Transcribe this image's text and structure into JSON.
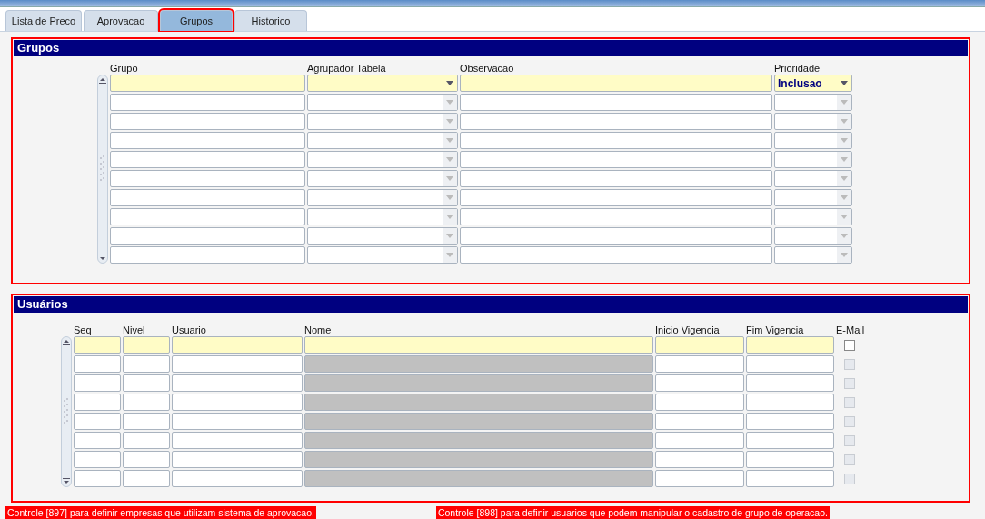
{
  "tabs": [
    {
      "label": "Lista de Preco",
      "selected": false
    },
    {
      "label": "Aprovacao",
      "selected": false
    },
    {
      "label": "Grupos",
      "selected": true
    },
    {
      "label": "Historico",
      "selected": false
    }
  ],
  "grupos": {
    "title": "Grupos",
    "columns": [
      {
        "label": "Grupo",
        "kind": "text"
      },
      {
        "label": "Agrupador Tabela",
        "kind": "dropdown"
      },
      {
        "label": "Observacao",
        "kind": "text"
      },
      {
        "label": "Prioridade",
        "kind": "dropdown"
      }
    ],
    "rows": [
      {
        "current": true,
        "prioridade": "Inclusao"
      },
      {
        "current": false
      },
      {
        "current": false
      },
      {
        "current": false
      },
      {
        "current": false
      },
      {
        "current": false
      },
      {
        "current": false
      },
      {
        "current": false
      },
      {
        "current": false
      },
      {
        "current": false
      }
    ]
  },
  "usuarios": {
    "title": "Usuários",
    "columns": [
      {
        "label": "Seq",
        "kind": "text"
      },
      {
        "label": "Nivel",
        "kind": "text"
      },
      {
        "label": "Usuario",
        "kind": "text"
      },
      {
        "label": "Nome",
        "kind": "readonly"
      },
      {
        "label": "Inicio Vigencia",
        "kind": "text"
      },
      {
        "label": "Fim Vigencia",
        "kind": "text"
      },
      {
        "label": "E-Mail",
        "kind": "checkbox"
      }
    ],
    "rows": [
      {
        "current": true,
        "checked": false
      },
      {
        "current": false,
        "checked": false
      },
      {
        "current": false,
        "checked": false
      },
      {
        "current": false,
        "checked": false
      },
      {
        "current": false,
        "checked": false
      },
      {
        "current": false,
        "checked": false
      },
      {
        "current": false,
        "checked": false
      },
      {
        "current": false,
        "checked": false
      }
    ]
  },
  "notes": [
    "Controle [897] para definir empresas que utilizam sistema de aprovacao.",
    "Controle [898] para definir usuarios que podem manipular o cadastro de grupo de operacao."
  ]
}
